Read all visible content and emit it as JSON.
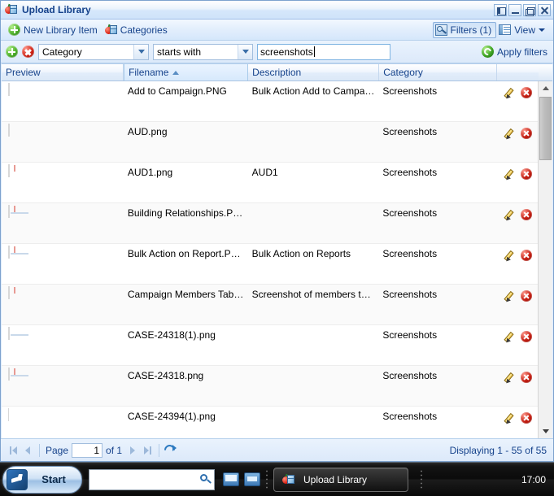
{
  "window": {
    "title": "Upload Library",
    "title_icon": "library-icon",
    "buttons": [
      {
        "name": "collapse",
        "glyph": "pin-icon"
      },
      {
        "name": "minimize",
        "glyph": "minimize-icon"
      },
      {
        "name": "restore",
        "glyph": "restore-icon"
      },
      {
        "name": "close",
        "glyph": "close-icon"
      }
    ]
  },
  "toolbar": {
    "new_library_item": "New Library Item",
    "categories": "Categories",
    "filters": "Filters (1)",
    "view": "View"
  },
  "filterbar": {
    "add_filter_icon": "add-icon",
    "remove_filter_icon": "remove-icon",
    "field": "Category",
    "operator": "starts with",
    "value": "screenshots",
    "apply": "Apply filters"
  },
  "grid": {
    "columns": [
      {
        "label": "Preview",
        "sorted": false
      },
      {
        "label": "Filename",
        "sorted": true,
        "dir": "asc"
      },
      {
        "label": "Description",
        "sorted": false
      },
      {
        "label": "Category",
        "sorted": false
      },
      {
        "label": "",
        "sorted": false
      }
    ],
    "rows": [
      {
        "filename": "Add to Campaign.PNG",
        "description": "Bulk Action Add to Campaig…",
        "category": "Screenshots",
        "thumb": "grid-wide"
      },
      {
        "filename": "AUD.png",
        "description": "",
        "category": "Screenshots",
        "thumb": "dialog"
      },
      {
        "filename": "AUD1.png",
        "description": "AUD1",
        "category": "Screenshots",
        "thumb": "form-red"
      },
      {
        "filename": "Building Relationships.PNG",
        "description": "",
        "category": "Screenshots",
        "thumb": "panel"
      },
      {
        "filename": "Bulk Action on Report.PNG",
        "description": "Bulk Action on Reports",
        "category": "Screenshots",
        "thumb": "report-red"
      },
      {
        "filename": "Campaign Members Tab…",
        "description": "Screenshot of members tab …",
        "category": "Screenshots",
        "thumb": "members-red"
      },
      {
        "filename": "CASE-24318(1).png",
        "description": "",
        "category": "Screenshots",
        "thumb": "case"
      },
      {
        "filename": "CASE-24318.png",
        "description": "",
        "category": "Screenshots",
        "thumb": "case2"
      },
      {
        "filename": "CASE-24394(1).png",
        "description": "",
        "category": "Screenshots",
        "thumb": "case3"
      }
    ],
    "row_actions": {
      "edit": "edit-pencil-icon",
      "delete": "delete-icon"
    }
  },
  "paging": {
    "first": "first-page",
    "prev": "previous-page",
    "page_label": "Page",
    "page_value": "1",
    "of_label": "of 1",
    "next": "next-page",
    "last": "last-page",
    "refresh": "refresh-icon",
    "status": "Displaying 1 - 55 of 55"
  },
  "taskbar": {
    "start": "Start",
    "search_placeholder": "",
    "search_value": "",
    "quick_launch": [
      "show-desktop-icon",
      "switch-window-icon"
    ],
    "task": "Upload Library",
    "clock": "17:00"
  },
  "colors": {
    "accent": "#15428b",
    "chrome": "#deecfd",
    "border": "#7da2ce",
    "danger": "#c41c10",
    "success": "#3fa523"
  }
}
